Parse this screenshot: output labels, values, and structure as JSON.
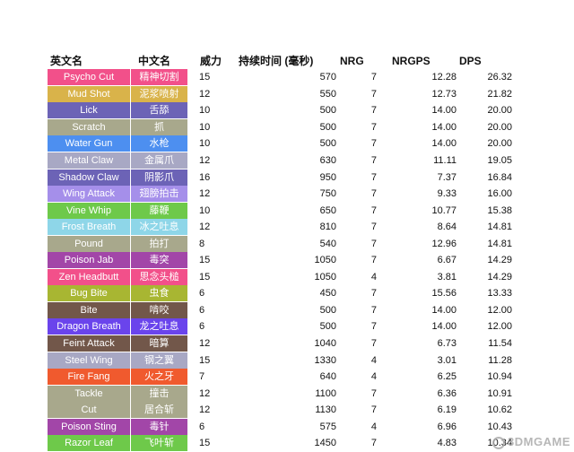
{
  "headers": {
    "en": "英文名",
    "cn": "中文名",
    "power": "威力",
    "duration": "持续时间 (毫秒)",
    "nrg": "NRG",
    "nrgps": "NRGPS",
    "dps": "DPS"
  },
  "rows": [
    {
      "en": "Psycho Cut",
      "cn": "精神切割",
      "power": "15",
      "duration": "570",
      "nrg": "7",
      "nrgps": "12.28",
      "dps": "26.32",
      "color": "#f2508a"
    },
    {
      "en": "Mud Shot",
      "cn": "泥浆喷射",
      "power": "12",
      "duration": "550",
      "nrg": "7",
      "nrgps": "12.73",
      "dps": "21.82",
      "color": "#d9b34a"
    },
    {
      "en": "Lick",
      "cn": "舌舔",
      "power": "10",
      "duration": "500",
      "nrg": "7",
      "nrgps": "14.00",
      "dps": "20.00",
      "color": "#6c63b6"
    },
    {
      "en": "Scratch",
      "cn": "抓",
      "power": "10",
      "duration": "500",
      "nrg": "7",
      "nrgps": "14.00",
      "dps": "20.00",
      "color": "#a8a88c"
    },
    {
      "en": "Water Gun",
      "cn": "水枪",
      "power": "10",
      "duration": "500",
      "nrg": "7",
      "nrgps": "14.00",
      "dps": "20.00",
      "color": "#4d8ff0"
    },
    {
      "en": "Metal Claw",
      "cn": "金属爪",
      "power": "12",
      "duration": "630",
      "nrg": "7",
      "nrgps": "11.11",
      "dps": "19.05",
      "color": "#a8a8c4"
    },
    {
      "en": "Shadow Claw",
      "cn": "阴影爪",
      "power": "16",
      "duration": "950",
      "nrg": "7",
      "nrgps": "7.37",
      "dps": "16.84",
      "color": "#6c63b6"
    },
    {
      "en": "Wing Attack",
      "cn": "翅膀拍击",
      "power": "12",
      "duration": "750",
      "nrg": "7",
      "nrgps": "9.33",
      "dps": "16.00",
      "color": "#a58fea"
    },
    {
      "en": "Vine Whip",
      "cn": "藤鞭",
      "power": "10",
      "duration": "650",
      "nrg": "7",
      "nrgps": "10.77",
      "dps": "15.38",
      "color": "#6ec94a"
    },
    {
      "en": "Frost Breath",
      "cn": "冰之吐息",
      "power": "12",
      "duration": "810",
      "nrg": "7",
      "nrgps": "8.64",
      "dps": "14.81",
      "color": "#8ed6e8"
    },
    {
      "en": "Pound",
      "cn": "拍打",
      "power": "8",
      "duration": "540",
      "nrg": "7",
      "nrgps": "12.96",
      "dps": "14.81",
      "color": "#a8a88c"
    },
    {
      "en": "Poison Jab",
      "cn": "毒突",
      "power": "15",
      "duration": "1050",
      "nrg": "7",
      "nrgps": "6.67",
      "dps": "14.29",
      "color": "#a246a8"
    },
    {
      "en": "Zen Headbutt",
      "cn": "思念头槌",
      "power": "15",
      "duration": "1050",
      "nrg": "4",
      "nrgps": "3.81",
      "dps": "14.29",
      "color": "#f2508a"
    },
    {
      "en": "Bug Bite",
      "cn": "虫食",
      "power": "6",
      "duration": "450",
      "nrg": "7",
      "nrgps": "15.56",
      "dps": "13.33",
      "color": "#a8b632"
    },
    {
      "en": "Bite",
      "cn": "啃咬",
      "power": "6",
      "duration": "500",
      "nrg": "7",
      "nrgps": "14.00",
      "dps": "12.00",
      "color": "#72574a"
    },
    {
      "en": "Dragon Breath",
      "cn": "龙之吐息",
      "power": "6",
      "duration": "500",
      "nrg": "7",
      "nrgps": "14.00",
      "dps": "12.00",
      "color": "#6a44ec"
    },
    {
      "en": "Feint Attack",
      "cn": "暗算",
      "power": "12",
      "duration": "1040",
      "nrg": "7",
      "nrgps": "6.73",
      "dps": "11.54",
      "color": "#72574a"
    },
    {
      "en": "Steel Wing",
      "cn": "钢之翼",
      "power": "15",
      "duration": "1330",
      "nrg": "4",
      "nrgps": "3.01",
      "dps": "11.28",
      "color": "#a8a8c4"
    },
    {
      "en": "Fire Fang",
      "cn": "火之牙",
      "power": "7",
      "duration": "640",
      "nrg": "4",
      "nrgps": "6.25",
      "dps": "10.94",
      "color": "#f05a2e"
    },
    {
      "en": "Tackle",
      "cn": "撞击",
      "power": "12",
      "duration": "1100",
      "nrg": "7",
      "nrgps": "6.36",
      "dps": "10.91",
      "color": "#a8a88c"
    },
    {
      "en": "Cut",
      "cn": "居合斩",
      "power": "12",
      "duration": "1130",
      "nrg": "7",
      "nrgps": "6.19",
      "dps": "10.62",
      "color": "#a8a88c"
    },
    {
      "en": "Poison Sting",
      "cn": "毒针",
      "power": "6",
      "duration": "575",
      "nrg": "4",
      "nrgps": "6.96",
      "dps": "10.43",
      "color": "#a246a8"
    },
    {
      "en": "Razor Leaf",
      "cn": "飞叶斩",
      "power": "15",
      "duration": "1450",
      "nrg": "7",
      "nrgps": "4.83",
      "dps": "10.34",
      "color": "#6ec94a"
    }
  ],
  "watermark": "3DMGAME"
}
